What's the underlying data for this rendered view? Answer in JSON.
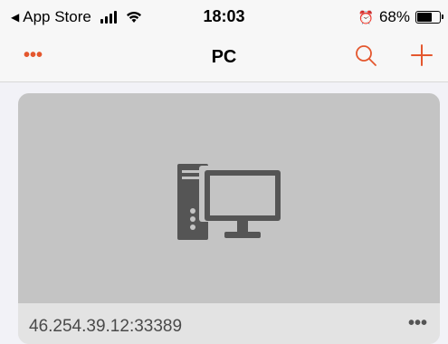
{
  "status_bar": {
    "back_app": "App Store",
    "time": "18:03",
    "battery_text": "68%",
    "battery_level": 0.68
  },
  "nav": {
    "more_label": "•••",
    "title": "PC",
    "accent_color": "#e4572e"
  },
  "connections": [
    {
      "address": "46.254.39.12:33389",
      "more_label": "•••",
      "icon": "pc-icon"
    }
  ]
}
